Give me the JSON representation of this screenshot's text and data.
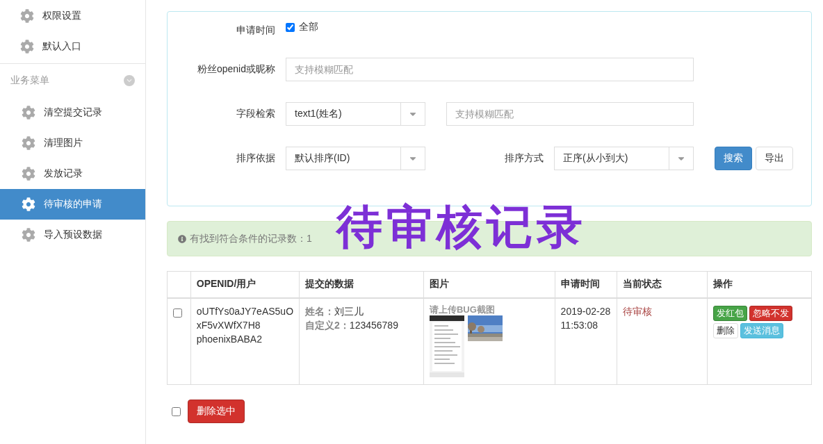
{
  "sidebar": {
    "top_items": [
      {
        "label": "权限设置",
        "selected": false
      },
      {
        "label": "默认入口",
        "selected": false
      }
    ],
    "section": {
      "title": "业务菜单"
    },
    "items": [
      {
        "label": "清空提交记录",
        "selected": false
      },
      {
        "label": "清理图片",
        "selected": false
      },
      {
        "label": "发放记录",
        "selected": false
      },
      {
        "label": "待审核的申请",
        "selected": true
      },
      {
        "label": "导入预设数据",
        "selected": false
      }
    ]
  },
  "filter": {
    "time": {
      "label": "申请时间",
      "option": "全部",
      "checked": true
    },
    "fan": {
      "label": "粉丝openid或昵称",
      "placeholder": "支持模糊匹配"
    },
    "field": {
      "label": "字段检索",
      "value": "text1(姓名)",
      "placeholder": "支持模糊匹配"
    },
    "sort_by": {
      "label": "排序依据",
      "value": "默认排序(ID)"
    },
    "sort_order": {
      "label": "排序方式",
      "value": "正序(从小到大)"
    },
    "buttons": [
      {
        "label": "搜索",
        "kind": "primary"
      },
      {
        "label": "导出",
        "kind": "default"
      }
    ]
  },
  "alert": "有找到符合条件的记录数：1",
  "annotation": "待审核记录",
  "table": {
    "columns": [
      "OPENID/用户",
      "提交的数据",
      "图片",
      "申请时间",
      "当前状态",
      "操作"
    ],
    "rows": [
      {
        "checked": false,
        "openid": [
          "oUTfYs0aJY7eAS5uO",
          "xF5vXWfX7H8",
          "phoenixBABA2"
        ],
        "data": [
          {
            "key": "姓名：",
            "value": "刘三儿"
          },
          {
            "key": "自定义2：",
            "value": "123456789"
          }
        ],
        "image_title": "请上传BUG截图",
        "images": [
          {
            "kind": "picture"
          },
          {
            "kind": "picture"
          }
        ],
        "time": [
          "2019-02-28",
          "11:53:08"
        ],
        "status": "待审核",
        "actions": [
          {
            "label": "发红包",
            "kind": "success"
          },
          {
            "label": "忽略不发",
            "kind": "danger"
          },
          {
            "label": "删除",
            "kind": "default"
          },
          {
            "label": "发送消息",
            "kind": "info"
          }
        ]
      }
    ]
  },
  "footer": {
    "checked": false,
    "button": "删除选中"
  }
}
